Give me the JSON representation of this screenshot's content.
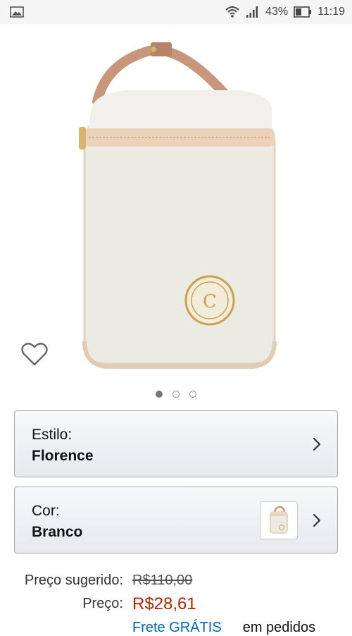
{
  "status_bar": {
    "battery": "43%",
    "time": "11:19"
  },
  "carousel": {
    "total": 3,
    "active": 0
  },
  "selectors": {
    "style": {
      "label": "Estilo:",
      "value": "Florence"
    },
    "color": {
      "label": "Cor:",
      "value": "Branco"
    }
  },
  "pricing": {
    "suggested_label": "Preço sugerido:",
    "suggested_value": "R$110,00",
    "price_label": "Preço:",
    "price_value": "R$28,61"
  },
  "shipping_peek": {
    "link": "Frete GRÁTIS",
    "rest": "em pedidos"
  },
  "icons": {
    "gallery": "image-icon",
    "wifi": "wifi-icon",
    "signal": "signal-icon",
    "battery": "battery-icon",
    "wishlist": "heart-outline-icon",
    "chevron": "chevron-right-icon"
  },
  "colors": {
    "price": "#b12704",
    "link": "#0066c0",
    "selector_border": "#a9a9a9"
  }
}
